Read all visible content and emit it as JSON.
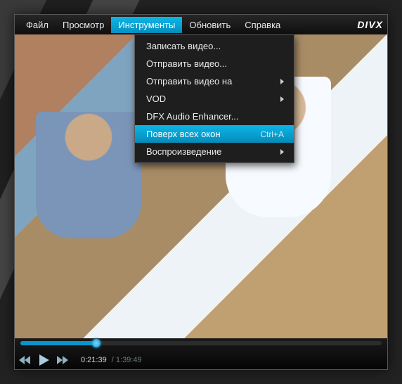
{
  "menubar": {
    "items": [
      {
        "label": "Файл",
        "active": false
      },
      {
        "label": "Просмотр",
        "active": false
      },
      {
        "label": "Инструменты",
        "active": true
      },
      {
        "label": "Обновить",
        "active": false
      },
      {
        "label": "Справка",
        "active": false
      }
    ],
    "logo": "DIVX"
  },
  "dropdown": {
    "items": [
      {
        "label": "Записать видео...",
        "submenu": false,
        "highlight": false,
        "shortcut": ""
      },
      {
        "label": "Отправить видео...",
        "submenu": false,
        "highlight": false,
        "shortcut": ""
      },
      {
        "label": "Отправить видео на",
        "submenu": true,
        "highlight": false,
        "shortcut": ""
      },
      {
        "label": "VOD",
        "submenu": true,
        "highlight": false,
        "shortcut": ""
      },
      {
        "label": "DFX Audio Enhancer...",
        "submenu": false,
        "highlight": false,
        "shortcut": ""
      },
      {
        "label": "Поверх всех окон",
        "submenu": false,
        "highlight": true,
        "shortcut": "Ctrl+A"
      },
      {
        "label": "Воспроизведение",
        "submenu": true,
        "highlight": false,
        "shortcut": ""
      }
    ]
  },
  "playback": {
    "current": "0:21:39",
    "total": "1:39:49",
    "progress_percent": 21
  },
  "colors": {
    "accent": "#0a9ed1"
  }
}
